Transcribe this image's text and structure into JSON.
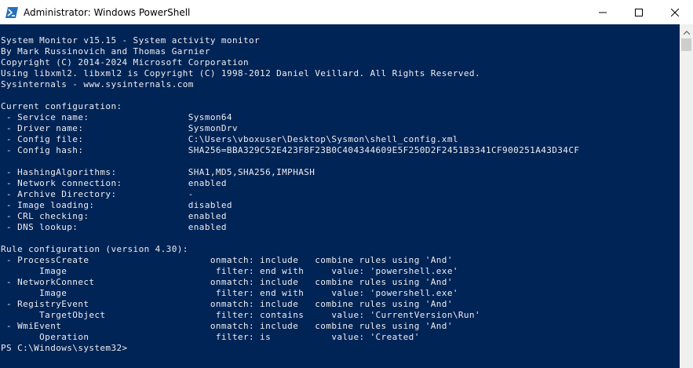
{
  "window": {
    "title": "Administrator: Windows PowerShell"
  },
  "icons": {
    "app": "powershell-icon",
    "minimize": "minimize-icon",
    "maximize": "maximize-icon",
    "close": "close-icon",
    "scroll_up": "chevron-up-icon"
  },
  "colors": {
    "console_background": "#012456",
    "console_text": "#eeedf0",
    "titlebar": "#ffffff"
  },
  "console": {
    "lines": [
      "System Monitor v15.15 - System activity monitor",
      "By Mark Russinovich and Thomas Garnier",
      "Copyright (C) 2014-2024 Microsoft Corporation",
      "Using libxml2. libxml2 is Copyright (C) 1998-2012 Daniel Veillard. All Rights Reserved.",
      "Sysinternals - www.sysinternals.com",
      "",
      "Current configuration:",
      " - Service name:                  Sysmon64",
      " - Driver name:                   SysmonDrv",
      " - Config file:                   C:\\Users\\vboxuser\\Desktop\\Sysmon\\shell_config.xml",
      " - Config hash:                   SHA256=BBA329C52E423F8F23B0C404344609E5F250D2F2451B3341CF900251A43D34CF",
      "",
      " - HashingAlgorithms:             SHA1,MD5,SHA256,IMPHASH",
      " - Network connection:            enabled",
      " - Archive Directory:             -",
      " - Image loading:                 disabled",
      " - CRL checking:                  enabled",
      " - DNS lookup:                    enabled",
      "",
      "Rule configuration (version 4.30):",
      " - ProcessCreate                      onmatch: include   combine rules using 'And'",
      "       Image                           filter: end with     value: 'powershell.exe'",
      " - NetworkConnect                     onmatch: include   combine rules using 'And'",
      "       Image                           filter: end with     value: 'powershell.exe'",
      " - RegistryEvent                      onmatch: include   combine rules using 'And'",
      "       TargetObject                    filter: contains     value: 'CurrentVersion\\Run'",
      " - WmiEvent                           onmatch: include   combine rules using 'And'",
      "       Operation                       filter: is           value: 'Created'",
      "PS C:\\Windows\\system32>"
    ]
  }
}
